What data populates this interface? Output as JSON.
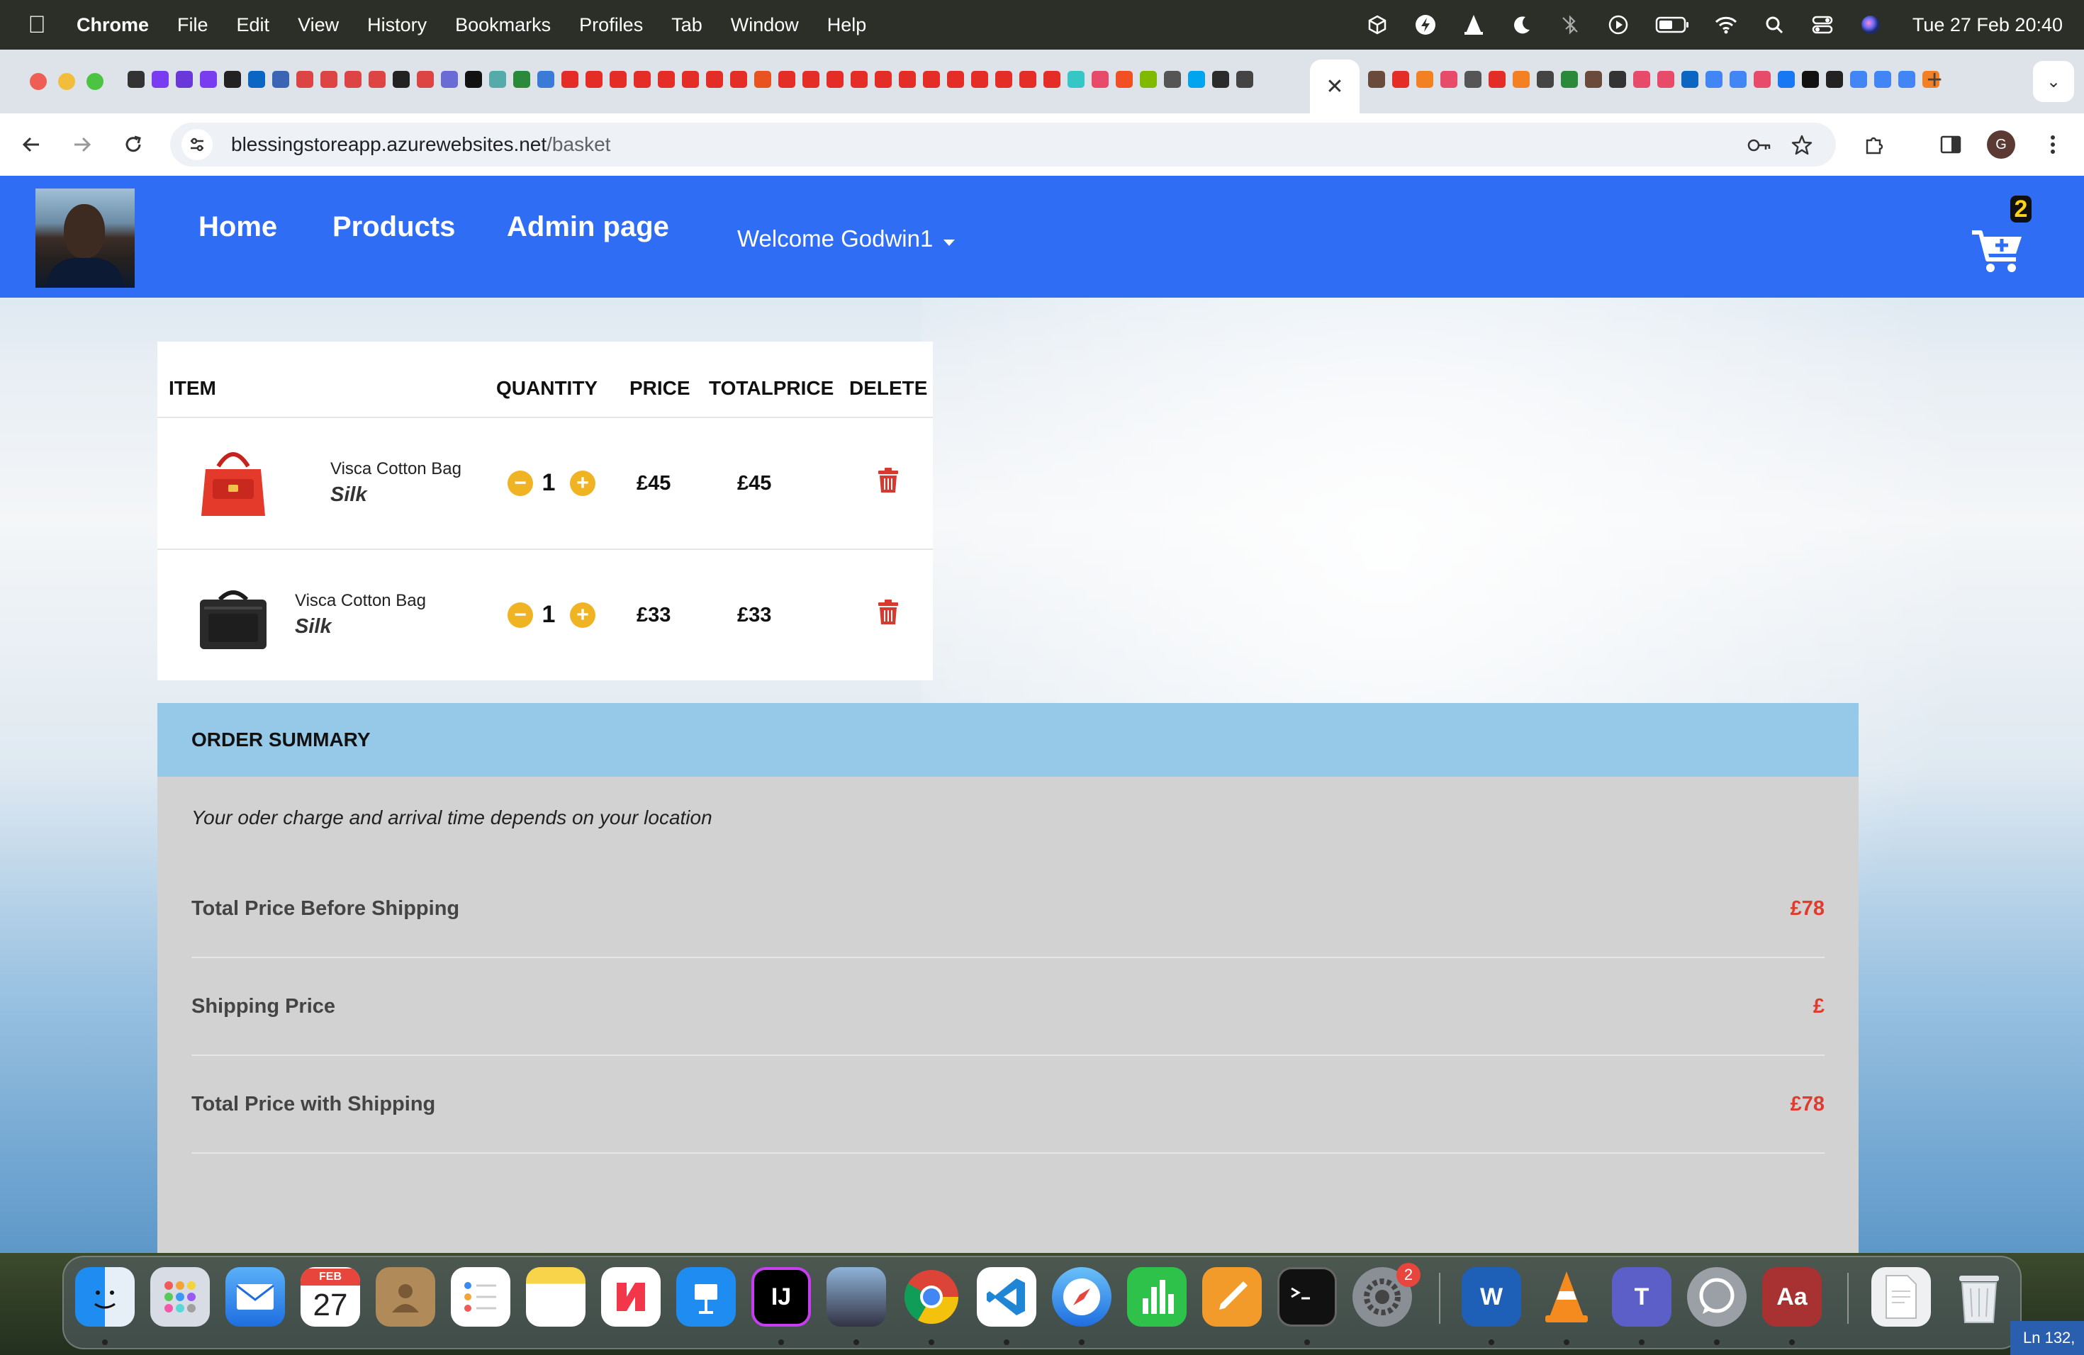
{
  "menubar": {
    "app_name": "Chrome",
    "items": [
      "File",
      "Edit",
      "View",
      "History",
      "Bookmarks",
      "Profiles",
      "Tab",
      "Window",
      "Help"
    ],
    "clock": "Tue 27 Feb  20:40"
  },
  "browser": {
    "url_host": "blessingstoreapp.azurewebsites.net",
    "url_path": "/basket",
    "profile_initial": "G"
  },
  "site": {
    "nav": {
      "home": "Home",
      "products": "Products",
      "admin": "Admin page",
      "welcome": "Welcome Godwin1"
    },
    "cart_count": "2",
    "accent_color": "#2f6df4"
  },
  "basket": {
    "headers": {
      "item": "ITEM",
      "quantity": "QUANTITY",
      "price": "PRICE",
      "total": "TOTALPRICE",
      "delete": "DELETE"
    },
    "rows": [
      {
        "name": "Visca Cotton Bag",
        "material": "Silk",
        "quantity": "1",
        "price": "£45",
        "total": "£45",
        "image": "red-handbag"
      },
      {
        "name": "Visca Cotton Bag",
        "material": "Silk",
        "quantity": "1",
        "price": "£33",
        "total": "£33",
        "image": "black-laptop-bag"
      }
    ]
  },
  "summary": {
    "title": "ORDER SUMMARY",
    "note": "Your oder charge and arrival time depends on your location",
    "rows": [
      {
        "label": "Total Price Before Shipping",
        "value": "£78"
      },
      {
        "label": "Shipping Price",
        "value": "£"
      },
      {
        "label": "Total Price with Shipping",
        "value": "£78"
      }
    ],
    "header_color": "#96c9e8",
    "value_color": "#e13b2d"
  },
  "dock": {
    "calendar_month": "FEB",
    "calendar_day": "27",
    "settings_badge": "2",
    "statusbar_text": "Ln 132,"
  }
}
